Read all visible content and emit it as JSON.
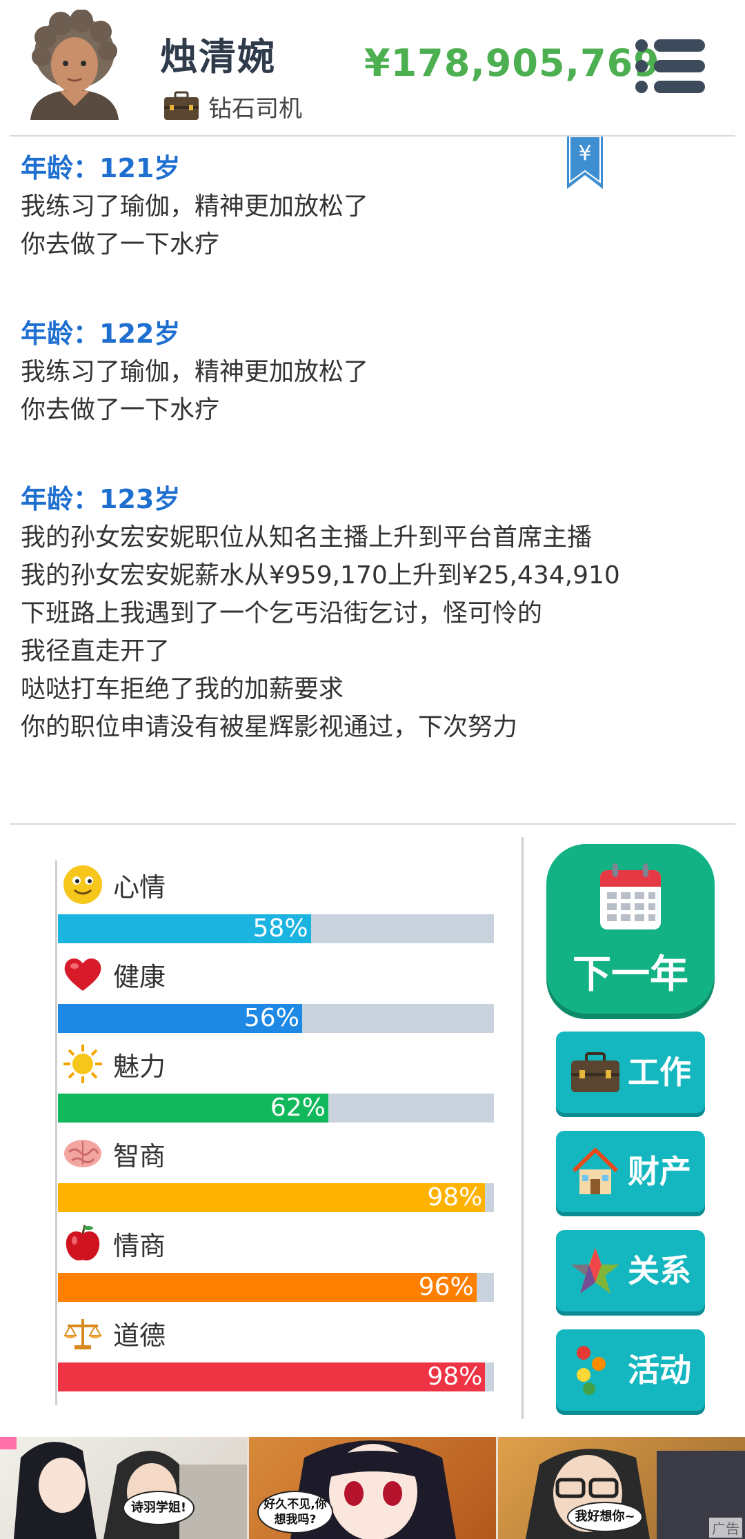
{
  "header": {
    "player_name": "烛清婉",
    "job_title": "钻石司机",
    "money": "¥178,905,769"
  },
  "colors": {
    "money": "#4caf50",
    "age_heading": "#1e6fd0",
    "next_year_button": "#13b285",
    "action_button": "#14b7bf"
  },
  "log": [
    {
      "age": "年龄：121岁",
      "events": [
        "我练习了瑜伽，精神更加放松了",
        "你去做了一下水疗"
      ]
    },
    {
      "age": "年龄：122岁",
      "events": [
        "我练习了瑜伽，精神更加放松了",
        "你去做了一下水疗"
      ]
    },
    {
      "age": "年龄：123岁",
      "events": [
        "我的孙女宏安妮职位从知名主播上升到平台首席主播",
        "我的孙女宏安妮薪水从¥959,170上升到¥25,434,910",
        "下班路上我遇到了一个乞丐沿街乞讨，怪可怜的",
        "我径直走开了",
        "哒哒打车拒绝了我的加薪要求",
        "你的职位申请没有被星辉影视通过，下次努力"
      ]
    }
  ],
  "stats": [
    {
      "label": "心情",
      "text": "58%",
      "percent": 58,
      "color": "#1bb3e0",
      "icon": "smiley-icon"
    },
    {
      "label": "健康",
      "text": "56%",
      "percent": 56,
      "color": "#1e88e5",
      "icon": "heart-icon"
    },
    {
      "label": "魅力",
      "text": "62%",
      "percent": 62,
      "color": "#12b85c",
      "icon": "sun-icon"
    },
    {
      "label": "智商",
      "text": "98%",
      "percent": 98,
      "color": "#ffb300",
      "icon": "brain-icon"
    },
    {
      "label": "情商",
      "text": "96%",
      "percent": 96,
      "color": "#ff7f00",
      "icon": "apple-icon"
    },
    {
      "label": "道德",
      "text": "98%",
      "percent": 98,
      "color": "#ee3344",
      "icon": "scales-icon"
    }
  ],
  "buttons": {
    "next_year": "下一年",
    "work": "工作",
    "property": "财产",
    "relations": "关系",
    "activities": "活动"
  },
  "ad": {
    "bubble_1": "诗羽学姐!",
    "bubble_2": "好久不见,你想我吗?",
    "bubble_3": "我好想你~",
    "label": "广告"
  }
}
